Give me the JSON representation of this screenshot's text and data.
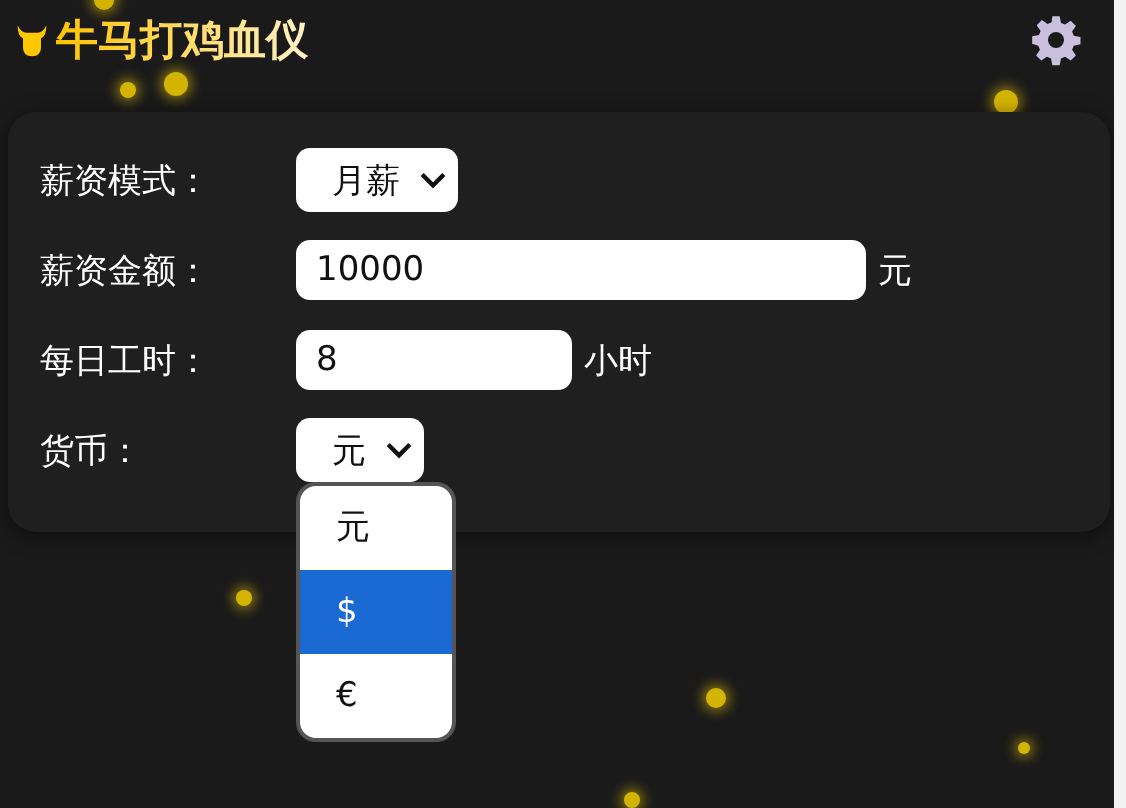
{
  "header": {
    "title": "牛马打鸡血仪"
  },
  "fields": [
    {
      "kind": "select",
      "label": "薪资模式：",
      "value": "月薪"
    },
    {
      "kind": "long-input",
      "label": "薪资金额：",
      "value": "10000",
      "unit": "元"
    },
    {
      "kind": "short-input",
      "label": "每日工时：",
      "value": "8",
      "unit": "小时"
    },
    {
      "kind": "select",
      "label": "货币：",
      "value": "元",
      "open": true
    }
  ],
  "dropdown": {
    "options": [
      {
        "label": "元",
        "selected": false
      },
      {
        "label": "$",
        "selected": true
      },
      {
        "label": "€",
        "selected": false
      }
    ]
  }
}
